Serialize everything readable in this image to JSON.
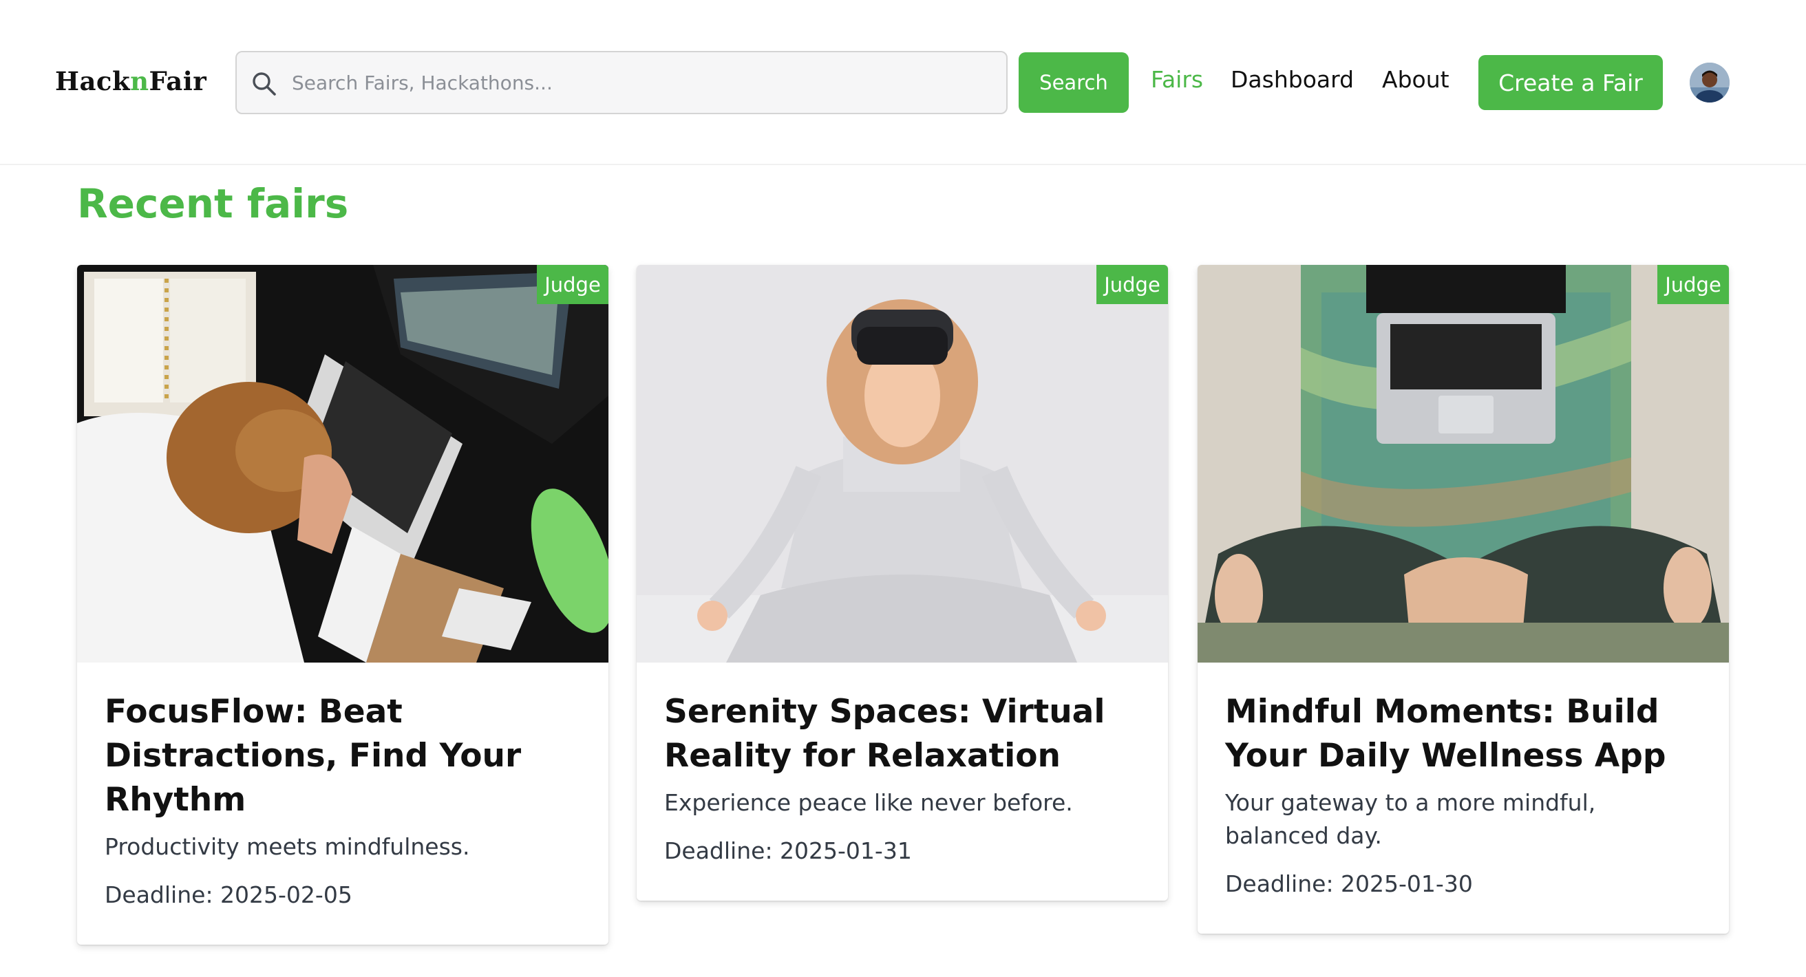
{
  "header": {
    "logo": {
      "part1": "Hack",
      "part2": "n",
      "part3": "Fair"
    },
    "search": {
      "placeholder": "Search Fairs, Hackathons...",
      "value": "",
      "button_label": "Search"
    },
    "nav": [
      {
        "label": "Fairs",
        "active": true
      },
      {
        "label": "Dashboard",
        "active": false
      },
      {
        "label": "About",
        "active": false
      }
    ],
    "create_label": "Create a Fair"
  },
  "main": {
    "section_title": "Recent fairs",
    "cards": [
      {
        "badge": "Judge",
        "title": "FocusFlow: Beat Distractions, Find Your Rhythm",
        "description": "Productivity meets mindfulness.",
        "deadline": "Deadline: 2025-02-05"
      },
      {
        "badge": "Judge",
        "title": "Serenity Spaces: Virtual Reality for Relaxation",
        "description": "Experience peace like never before.",
        "deadline": "Deadline: 2025-01-31"
      },
      {
        "badge": "Judge",
        "title": "Mindful Moments: Build Your Daily Wellness App",
        "description": "Your gateway to a more mindful, balanced day.",
        "deadline": "Deadline: 2025-01-30"
      }
    ]
  },
  "colors": {
    "accent": "#4cb848",
    "text": "#111111",
    "muted_text": "#333a44"
  },
  "icons": [
    "search-icon",
    "user-avatar"
  ]
}
